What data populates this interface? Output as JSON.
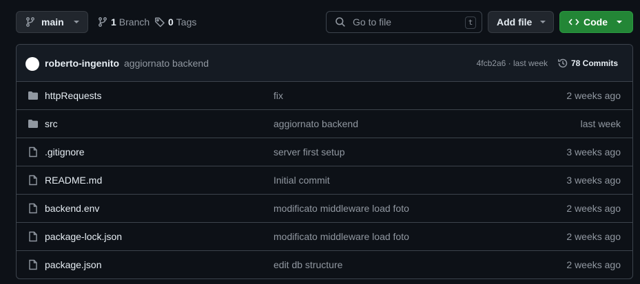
{
  "toolbar": {
    "branch_name": "main",
    "branches_count": "1",
    "branches_label": "Branch",
    "tags_count": "0",
    "tags_label": "Tags",
    "search_placeholder": "Go to file",
    "search_shortcut": "t",
    "add_file_label": "Add file",
    "code_label": "Code"
  },
  "colors": {
    "background": "#0d1117",
    "code_button": "#238636",
    "muted_text": "#9198a1",
    "border": "#3d444d"
  },
  "latest_commit": {
    "author": "roberto-ingenito",
    "message": "aggiornato backend",
    "sha_info": "4fcb2a6 · last week",
    "commits_label": "78 Commits"
  },
  "files": [
    {
      "type": "folder",
      "name": "httpRequests",
      "message": "fix",
      "date": "2 weeks ago"
    },
    {
      "type": "folder",
      "name": "src",
      "message": "aggiornato backend",
      "date": "last week"
    },
    {
      "type": "file",
      "name": ".gitignore",
      "message": "server first setup",
      "date": "3 weeks ago"
    },
    {
      "type": "file",
      "name": "README.md",
      "message": "Initial commit",
      "date": "3 weeks ago"
    },
    {
      "type": "file",
      "name": "backend.env",
      "message": "modificato middleware load foto",
      "date": "2 weeks ago"
    },
    {
      "type": "file",
      "name": "package-lock.json",
      "message": "modificato middleware load foto",
      "date": "2 weeks ago"
    },
    {
      "type": "file",
      "name": "package.json",
      "message": "edit db structure",
      "date": "2 weeks ago"
    }
  ]
}
